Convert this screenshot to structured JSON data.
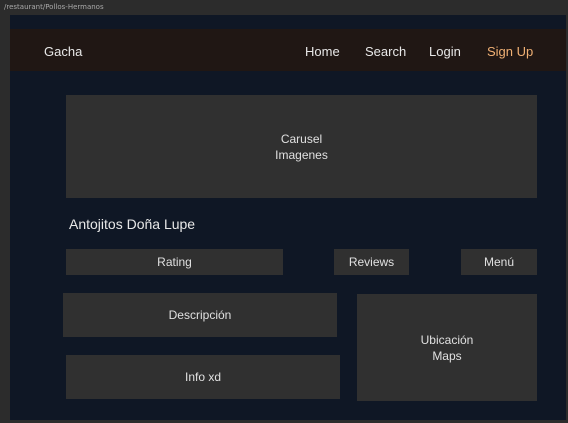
{
  "frame_label": "/restaurant/Pollos-Hermanos",
  "navbar": {
    "brand": "Gacha",
    "links": {
      "home": "Home",
      "search": "Search",
      "login": "Login",
      "signup": "Sign Up"
    },
    "signup_color": "#f0b074"
  },
  "carousel": {
    "line1": "Carusel",
    "line2": "Imagenes"
  },
  "restaurant_name": "Antojitos Doña Lupe",
  "buttons": {
    "rating": "Rating",
    "reviews": "Reviews",
    "menu": "Menú"
  },
  "sections": {
    "descripcion": "Descripción",
    "info": "Info xd",
    "ubicacion_line1": "Ubicación",
    "ubicacion_line2": "Maps"
  },
  "colors": {
    "page_background": "#0f1725",
    "navbar_background": "#201714",
    "box_background": "#303030"
  }
}
